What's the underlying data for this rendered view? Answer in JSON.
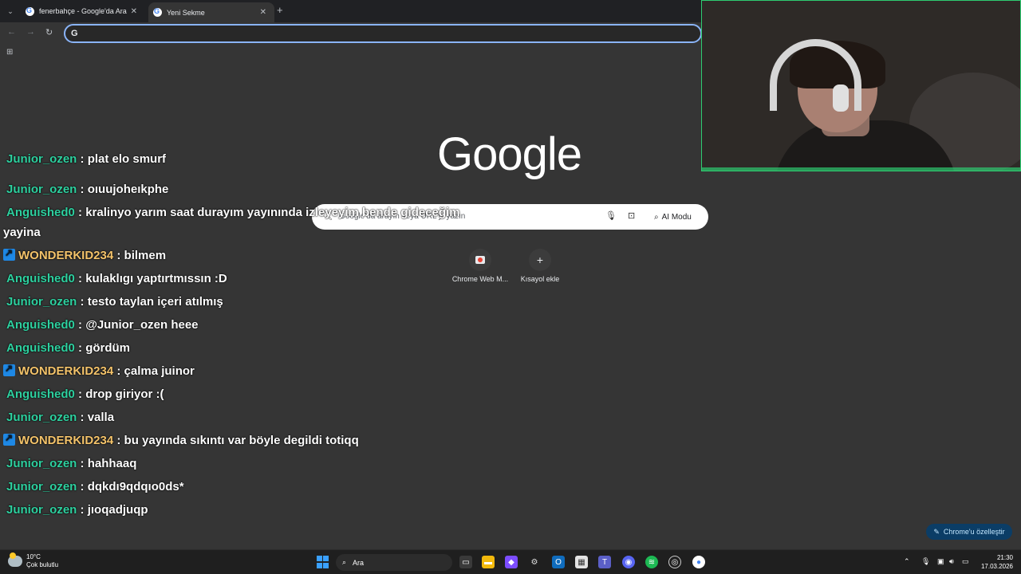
{
  "browser": {
    "tabs": [
      {
        "title": "fenerbahçe - Google'da Ara",
        "active": false
      },
      {
        "title": "Yeni Sekme",
        "active": true
      }
    ],
    "omnibox_value": ""
  },
  "ntp": {
    "logo_text": "Google",
    "search_placeholder": "Google'da arayın veya URL'yi yazın",
    "ai_mode_label": "AI Modu",
    "shortcuts": [
      {
        "label": "Chrome Web M..."
      },
      {
        "label": "Kısayol ekle"
      }
    ],
    "customize_label": "Chrome'u özelleştir"
  },
  "chat": {
    "partial_top": {
      "user": "Junior_ozen",
      "text": "plat elo smurf"
    },
    "messages": [
      {
        "user": "Junior_ozen",
        "text": "oıuujoheıkphe",
        "badge": false
      },
      {
        "user": "Anguished0",
        "text": "kralinyo yarım saat durayım yayınında izleyeyim bende gideceğim",
        "badge": false
      },
      {
        "user": "",
        "text": "yayina",
        "badge": false
      },
      {
        "user": "WONDERKID234",
        "text": "bilmem",
        "badge": true
      },
      {
        "user": "Anguished0",
        "text": "kulaklıgı yaptırtmıssın :D",
        "badge": false
      },
      {
        "user": "Junior_ozen",
        "text": "testo taylan içeri atılmış",
        "badge": false
      },
      {
        "user": "Anguished0",
        "text": "@Junior_ozen heee",
        "badge": false
      },
      {
        "user": "Anguished0",
        "text": "gördüm",
        "badge": false
      },
      {
        "user": "WONDERKID234",
        "text": "çalma juinor",
        "badge": true
      },
      {
        "user": "Anguished0",
        "text": "drop giriyor :(",
        "badge": false
      },
      {
        "user": "Junior_ozen",
        "text": "valla",
        "badge": false
      },
      {
        "user": "WONDERKID234",
        "text": "bu yayında sıkıntı var böyle degildi totiqq",
        "badge": true
      },
      {
        "user": "Junior_ozen",
        "text": "hahhaaq",
        "badge": false
      },
      {
        "user": "Junior_ozen",
        "text": "dqkdı9qdqıo0ds*",
        "badge": false
      },
      {
        "user": "Junior_ozen",
        "text": "jıoqadjuqp",
        "badge": false
      }
    ],
    "separator": " : "
  },
  "taskbar": {
    "weather_temp": "10°C",
    "weather_desc": "Çok bulutlu",
    "search_label": "Ara",
    "time": "21:30",
    "date": "17.03.2026"
  },
  "colors": {
    "accent": "#8ab4f8",
    "chat_user_green": "#2ed1a0",
    "chat_user_gold": "#f5c46b",
    "webcam_border": "#2ecc71"
  }
}
